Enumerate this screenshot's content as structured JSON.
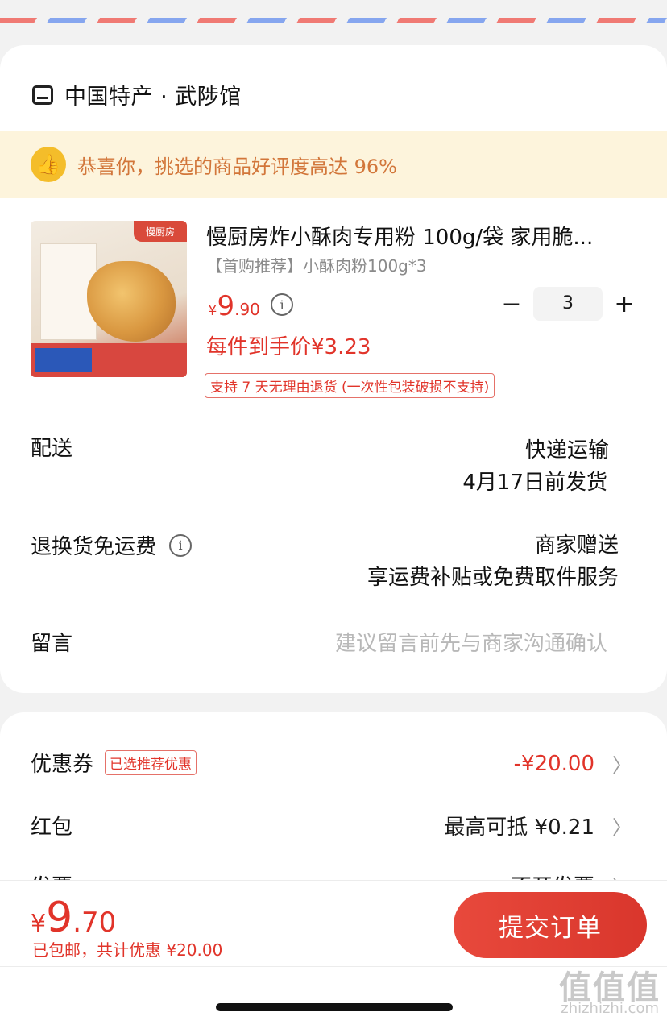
{
  "shop": {
    "icon": "store-icon",
    "name": "中国特产 · 武陟馆"
  },
  "banner": {
    "icon": "thumbs-up-icon",
    "text": "恭喜你，挑选的商品好评度高达 96%"
  },
  "product": {
    "title": "慢厨房炸小酥肉专用粉 100g/袋 家用脆...",
    "sku": "【首购推荐】小酥肉粉100g*3",
    "price_yen": "¥",
    "price_int": "9",
    "price_dec": ".90",
    "unit_price": "每件到手价¥3.23",
    "return_policy": "支持 7 天无理由退货 (一次性包装破损不支持)",
    "quantity": "3",
    "minus": "−",
    "plus": "+",
    "image": {
      "brand": "慢厨房"
    }
  },
  "shipping": {
    "label": "配送",
    "method": "快递运输",
    "ship_date": "4月17日前发货"
  },
  "return_shipping": {
    "label": "退换货免运费",
    "line1": "商家赠送",
    "line2": "享运费补贴或免费取件服务"
  },
  "message": {
    "label": "留言",
    "placeholder": "建议留言前先与商家沟通确认"
  },
  "discounts": {
    "coupon": {
      "label": "优惠券",
      "tag": "已选推荐优惠",
      "value": "-¥20.00"
    },
    "red_packet": {
      "label": "红包",
      "value": "最高可抵 ¥0.21"
    },
    "invoice": {
      "label": "发票",
      "value": "不开发票"
    }
  },
  "footer": {
    "total_yen": "¥",
    "total_int": "9",
    "total_dec": ".70",
    "subtotal": "已包邮，共计优惠 ¥20.00",
    "submit": "提交订单"
  },
  "watermark": {
    "main": "值值值",
    "sub": "zhizhizhi.com"
  },
  "colors": {
    "accent": "#e1342a",
    "banner_bg": "#fdf4dc",
    "banner_text": "#d2763a",
    "thumb": "#f4bd2a"
  }
}
